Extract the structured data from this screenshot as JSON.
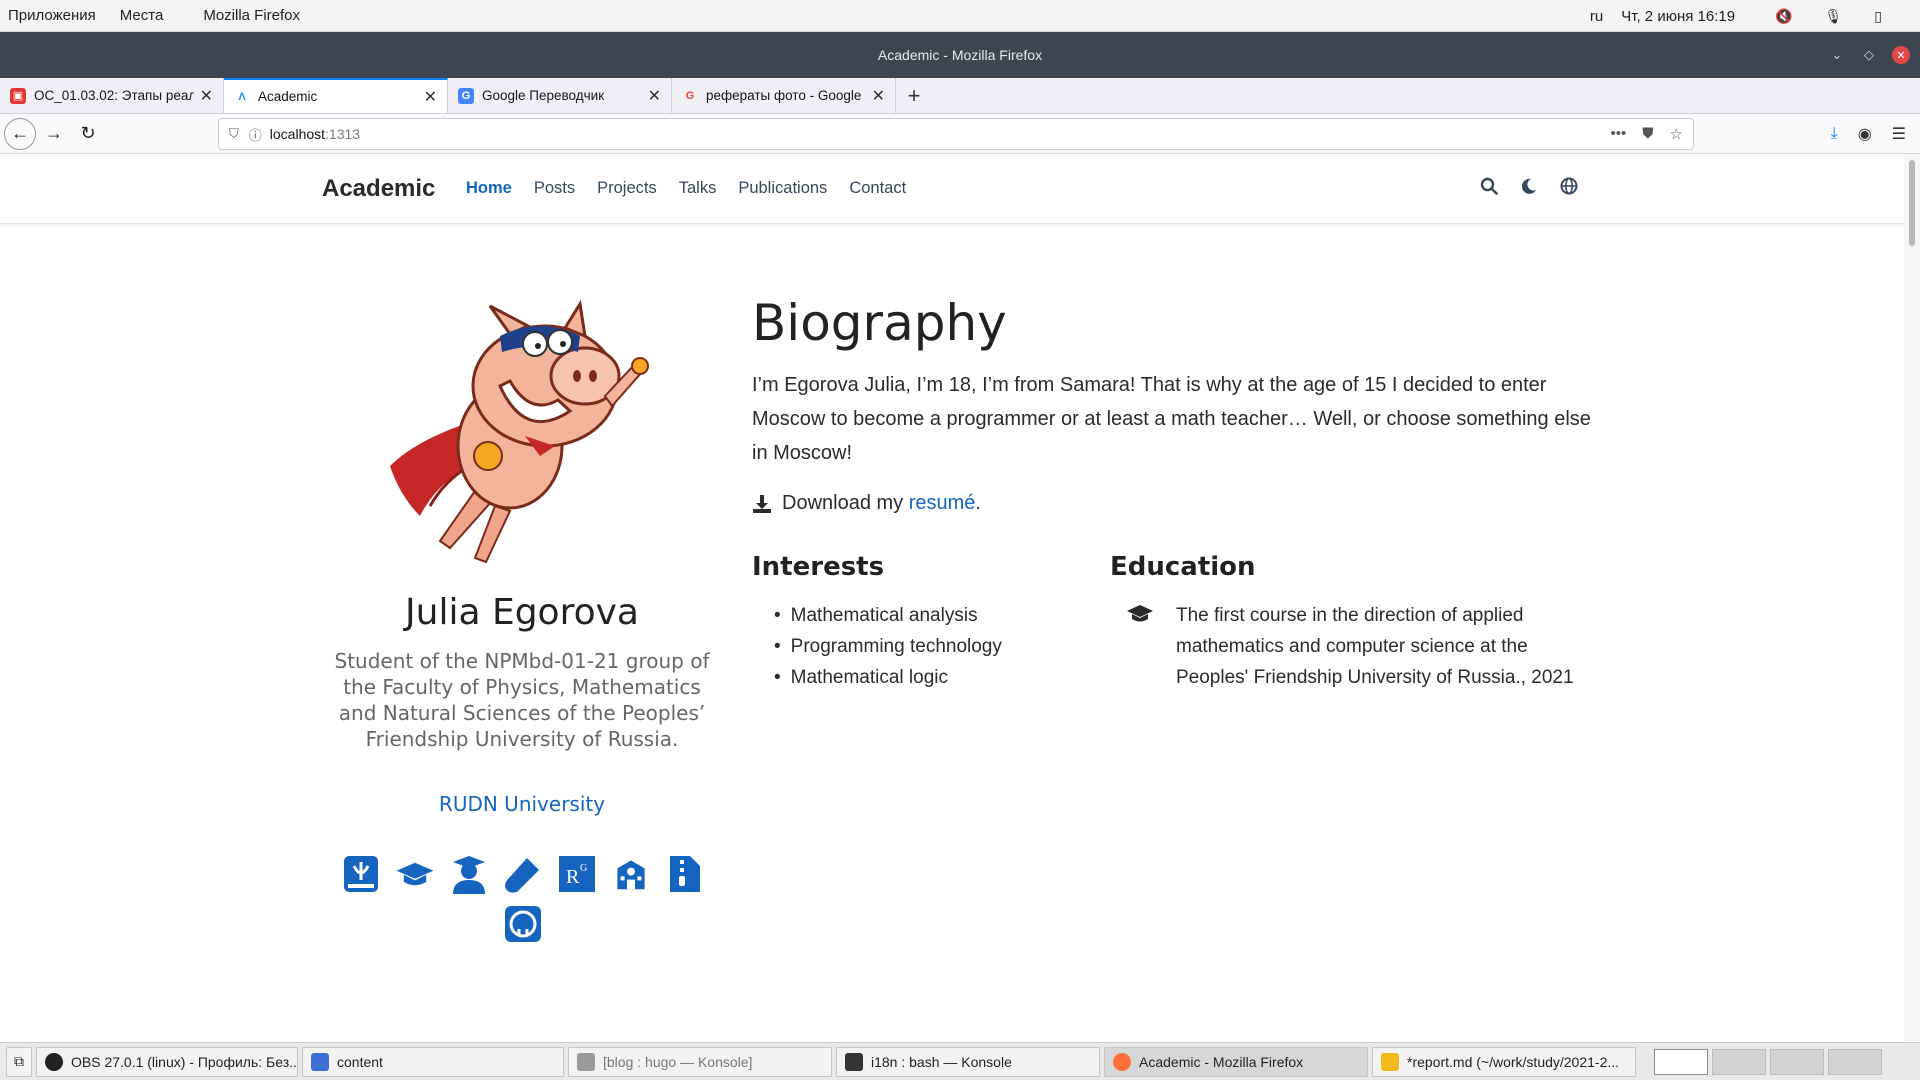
{
  "system": {
    "menu_apps": "Приложения",
    "menu_places": "Места",
    "menu_firefox": "Mozilla Firefox",
    "lang": "ru",
    "datetime": "Чт, 2 июня  16:19"
  },
  "window": {
    "title": "Academic - Mozilla Firefox"
  },
  "tabs": [
    {
      "title": "ОС_01.03.02: Этапы реал",
      "favicon_color": "#e23636"
    },
    {
      "title": "Academic",
      "favicon_color": "#1e88e5"
    },
    {
      "title": "Google Переводчик",
      "favicon_color": "#4285f4"
    },
    {
      "title": "рефераты фото - Google",
      "favicon_color": "#fbbc05"
    }
  ],
  "urlbar": {
    "host": "localhost",
    "port": ":1313"
  },
  "site": {
    "brand": "Academic",
    "nav": [
      "Home",
      "Posts",
      "Projects",
      "Talks",
      "Publications",
      "Contact"
    ]
  },
  "profile": {
    "name": "Julia Egorova",
    "role": "Student of the NPMbd-01-21 group of the Faculty of Physics, Mathematics and Natural Sciences of the Peoples’ Friendship University of Russia.",
    "org": "RUDN University"
  },
  "bio": {
    "title": "Biography",
    "text": "I’m Egorova Julia, I’m 18, I’m from Samara! That is why at the age of 15 I decided to enter Moscow to become a programmer or at least a math teacher… Well, or choose something else in Moscow!",
    "download_prefix": "Download my ",
    "download_link": "resumé",
    "download_suffix": "."
  },
  "interests": {
    "heading": "Interests",
    "items": [
      "Mathematical analysis",
      "Programming technology",
      "Mathematical logic"
    ]
  },
  "education": {
    "heading": "Education",
    "text": "The first course in the direction of applied mathematics and computer science at the Peoples' Friendship University of Russia., 2021"
  },
  "taskbar": [
    {
      "label": "OBS 27.0.1 (linux) - Профиль: Без...",
      "icon_color": "#222222"
    },
    {
      "label": "content",
      "icon_color": "#3b6fd6"
    },
    {
      "label": "[blog : hugo — Konsole]",
      "icon_color": "#7a7a7a"
    },
    {
      "label": "i18n : bash — Konsole",
      "icon_color": "#333333"
    },
    {
      "label": "Academic - Mozilla Firefox",
      "icon_color": "#ff7139"
    },
    {
      "label": "*report.md (~/work/study/2021-2...",
      "icon_color": "#f2b91c"
    }
  ],
  "colors": {
    "accent": "#1565c0",
    "titlebar": "#3d4650"
  }
}
